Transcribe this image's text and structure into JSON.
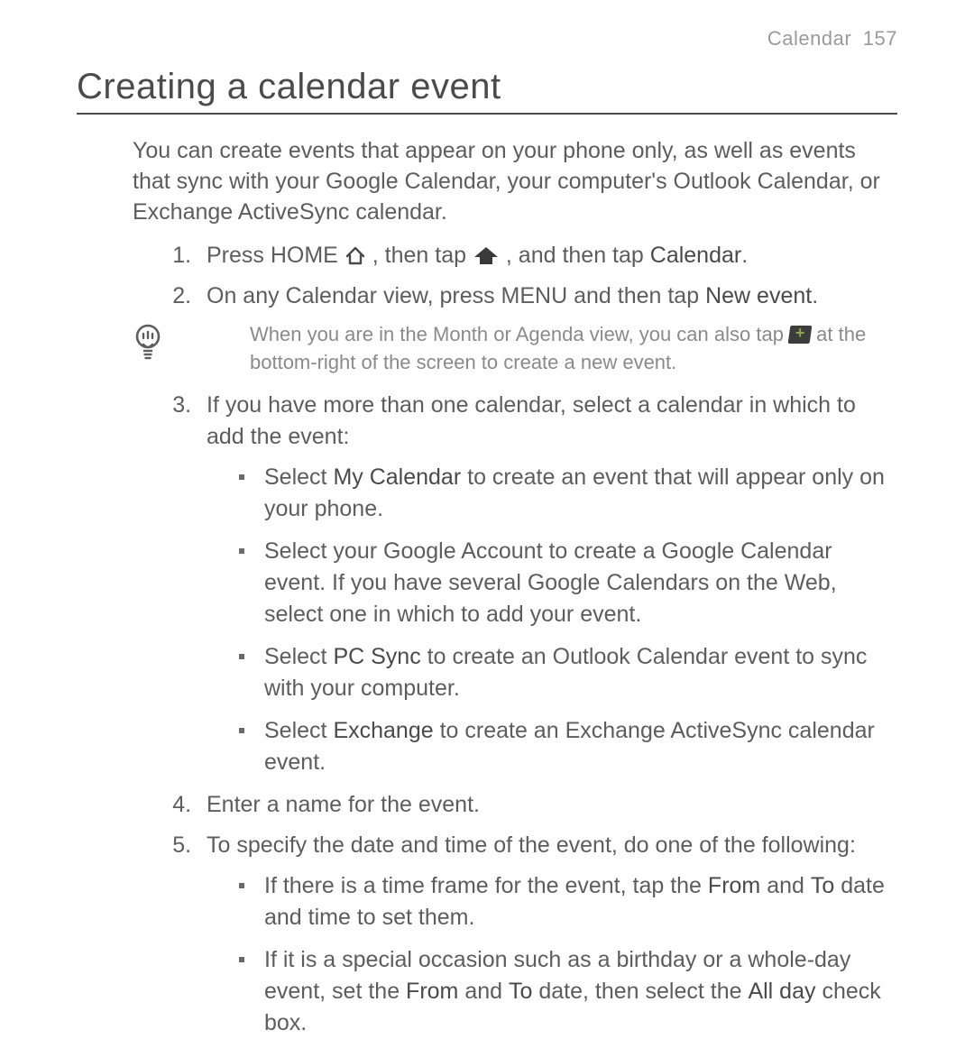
{
  "running_head": {
    "section": "Calendar",
    "page": "157"
  },
  "title": "Creating a calendar event",
  "intro": "You can create events that appear on your phone only, as well as events that sync with your Google Calendar, your computer's Outlook Calendar, or Exchange ActiveSync calendar.",
  "steps": {
    "s1": {
      "a": "Press HOME ",
      "b": ", then tap ",
      "c": ", and then tap ",
      "calendar": "Calendar",
      "d": "."
    },
    "s2": {
      "a": "On any Calendar view, press MENU and then tap ",
      "newevent": "New event",
      "b": "."
    },
    "tip": {
      "a": "When you are in the Month or Agenda view, you can also tap ",
      "b": " at the bottom-right of the screen to create a new event."
    },
    "s3": {
      "lead": "If you have more than one calendar, select a calendar in which to add the event:",
      "b1": {
        "a": "Select ",
        "mycal": "My Calendar",
        "b": " to create an event that will appear only on your phone."
      },
      "b2": "Select your Google Account to create a Google Calendar event. If you have several Google Calendars on the Web, select one in which to add your event.",
      "b3": {
        "a": "Select ",
        "pcsync": "PC Sync",
        "b": " to create an Outlook Calendar event to sync with your computer."
      },
      "b4": {
        "a": "Select ",
        "exch": "Exchange",
        "b": " to create an Exchange ActiveSync calendar event."
      }
    },
    "s4": "Enter a name for the event.",
    "s5": {
      "lead": "To specify the date and time of the event, do one of the following:",
      "b1": {
        "a": "If there is a time frame for the event, tap the ",
        "from": "From",
        "b": " and ",
        "to": "To",
        "c": " date and time to set them."
      },
      "b2": {
        "a": "If it is a special occasion such as a birthday or a whole-day event, set the ",
        "from": "From",
        "b": " and ",
        "to": "To",
        "c": " date, then select the ",
        "allday": "All day",
        "d": " check box."
      }
    }
  },
  "icons": {
    "home_outline": "home-outline-icon",
    "home_solid": "home-solid-icon",
    "lightbulb": "lightbulb-tip-icon",
    "plus_tile": "new-event-plus-icon"
  }
}
